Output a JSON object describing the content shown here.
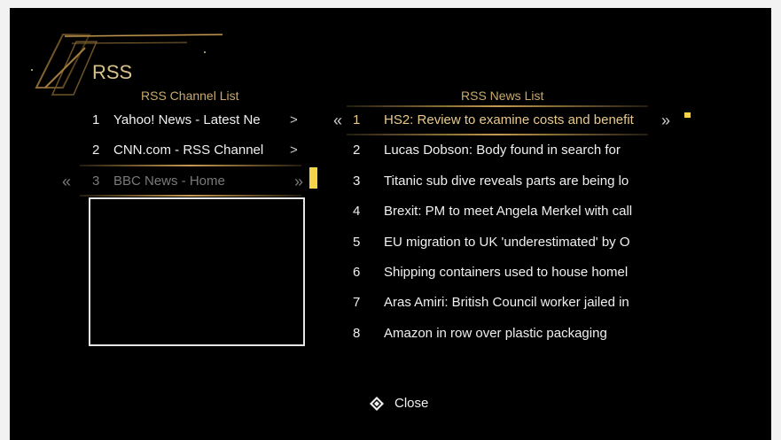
{
  "page": {
    "title": "RSS"
  },
  "channels": {
    "heading": "RSS Channel List",
    "items": [
      {
        "num": "1",
        "label": "Yahoo! News - Latest Ne",
        "arrow": ">"
      },
      {
        "num": "2",
        "label": "CNN.com - RSS Channel",
        "arrow": ">"
      },
      {
        "num": "3",
        "label": "BBC News - Home",
        "arrow": ""
      }
    ],
    "selected_left_arrow": "«",
    "selected_right_arrow": "»"
  },
  "news": {
    "heading": "RSS News List",
    "items": [
      {
        "num": "1",
        "label": "HS2: Review to examine costs and benefit"
      },
      {
        "num": "2",
        "label": "Lucas Dobson: Body found in search for"
      },
      {
        "num": "3",
        "label": "Titanic sub dive reveals parts are being lo"
      },
      {
        "num": "4",
        "label": "Brexit: PM to meet Angela Merkel with call"
      },
      {
        "num": "5",
        "label": "EU migration to UK 'underestimated' by O"
      },
      {
        "num": "6",
        "label": "Shipping containers used to house homel"
      },
      {
        "num": "7",
        "label": "Aras Amiri: British Council worker jailed in"
      },
      {
        "num": "8",
        "label": "Amazon in row over plastic packaging"
      }
    ],
    "selected_left_arrow": "«",
    "selected_right_arrow": "»"
  },
  "footer": {
    "close_label": "Close",
    "icon": "dpad-icon"
  },
  "colors": {
    "accent": "#c59a50",
    "highlight": "#f5d34a",
    "background": "#000000"
  }
}
